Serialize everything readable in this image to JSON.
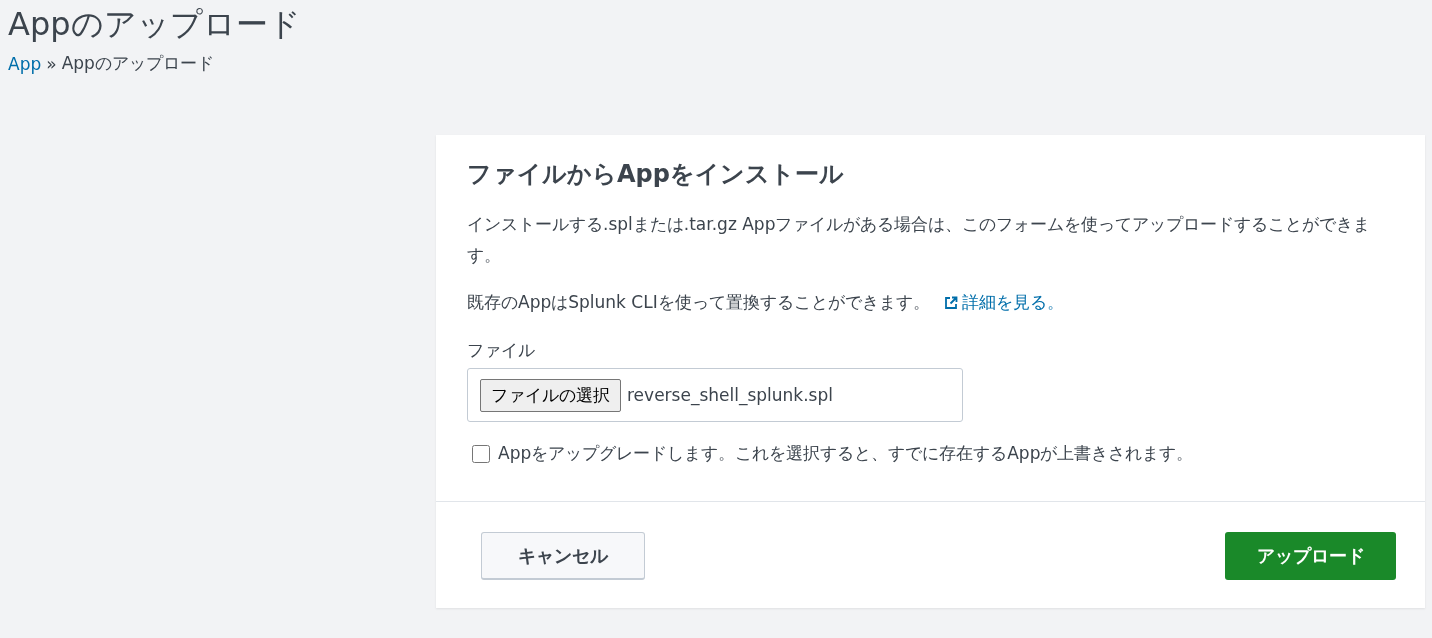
{
  "page": {
    "title": "Appのアップロード"
  },
  "breadcrumb": [
    {
      "label": "App",
      "kind": "link"
    },
    {
      "label": "»",
      "kind": "separator"
    },
    {
      "label": "Appのアップロード",
      "kind": "current"
    }
  ],
  "card": {
    "heading": "ファイルからAppをインストール",
    "description": "インストールする.splまたは.tar.gz Appファイルがある場合は、このフォームを使ってアップロードすることができます。",
    "note": "既存のAppはSplunk CLIを使って置換することができます。",
    "link": "詳細を見る。",
    "file_label": "ファイル",
    "file_button": "ファイルの選択",
    "file_name": "reverse_shell_splunk.spl",
    "upgrade": {
      "label": "Appをアップグレードします。これを選択すると、すでに存在するAppが上書きされます。",
      "checked": false
    },
    "cancel_button": "キャンセル",
    "upload_button": "アップロード"
  }
}
